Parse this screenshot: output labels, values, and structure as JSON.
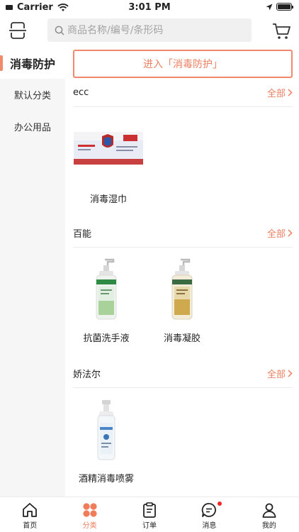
{
  "status_bar": {
    "carrier": "Carrier",
    "time": "3:01 PM"
  },
  "header": {
    "search_placeholder": "商品名称/编号/条形码"
  },
  "sidebar": {
    "items": [
      {
        "label": "消毒防护",
        "active": true
      },
      {
        "label": "默认分类",
        "active": false
      },
      {
        "label": "办公用品",
        "active": false
      }
    ]
  },
  "content": {
    "enter_label": "进入「消毒防护」",
    "see_all_label": "全部",
    "sections": [
      {
        "title": "ecc",
        "products": [
          {
            "name": "消毒湿巾"
          }
        ]
      },
      {
        "title": "百能",
        "products": [
          {
            "name": "抗菌洗手液"
          },
          {
            "name": "消毒凝胶"
          }
        ]
      },
      {
        "title": "娇法尔",
        "products": [
          {
            "name": "酒精消毒喷雾"
          }
        ]
      }
    ]
  },
  "tabbar": {
    "items": [
      {
        "label": "首页",
        "icon": "home-icon"
      },
      {
        "label": "分类",
        "icon": "category-icon",
        "active": true
      },
      {
        "label": "订单",
        "icon": "order-icon"
      },
      {
        "label": "消息",
        "icon": "message-icon",
        "badge": true
      },
      {
        "label": "我的",
        "icon": "profile-icon"
      }
    ]
  },
  "colors": {
    "accent": "#f07c59",
    "badge": "#ee2b2b",
    "sidebar_bg": "#f6f6f6"
  }
}
